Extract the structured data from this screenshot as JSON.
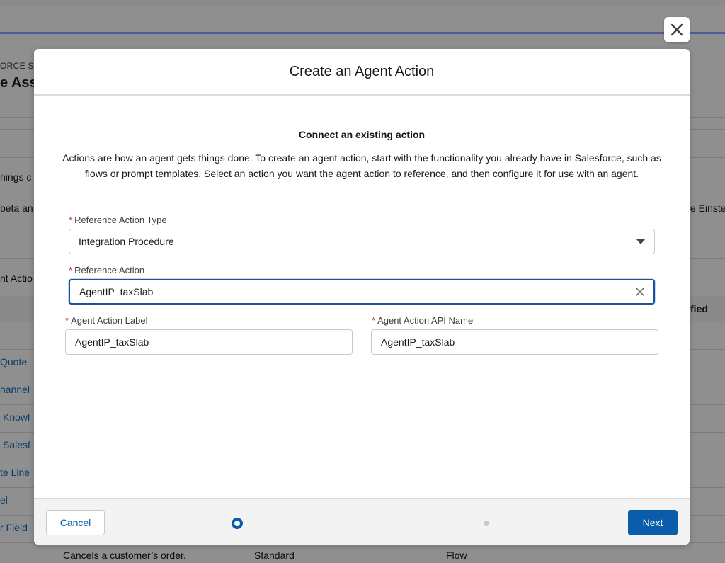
{
  "background": {
    "eyebrow": "ORCE S",
    "title": "e Ass",
    "left_texts": [
      "hings c",
      "beta an",
      "nt Actio"
    ],
    "right_text": "e Einste",
    "column_header_right": "fied",
    "list_links": [
      "Quote",
      "hannel",
      "Knowl",
      "Salesf",
      "te Line",
      "el",
      "r Field"
    ],
    "bottom_row": {
      "description": "Cancels a customer’s order.",
      "type": "Standard",
      "kind": "Flow"
    }
  },
  "close_button": {
    "icon": "close-icon"
  },
  "modal": {
    "title": "Create an Agent Action",
    "section_title": "Connect an existing action",
    "description": "Actions are how an agent gets things done. To create an agent action, start with the functionality you already have in Salesforce, such as flows or prompt templates. Select an action you want the agent action to reference, and then configure it for use with an agent.",
    "required_marker": "*",
    "fields": {
      "reference_action_type": {
        "label": "Reference Action Type",
        "value": "Integration Procedure"
      },
      "reference_action": {
        "label": "Reference Action",
        "value": "AgentIP_taxSlab"
      },
      "agent_action_label": {
        "label": "Agent Action Label",
        "value": "AgentIP_taxSlab"
      },
      "agent_action_api_name": {
        "label": "Agent Action API Name",
        "value": "AgentIP_taxSlab"
      }
    },
    "footer": {
      "cancel_label": "Cancel",
      "next_label": "Next",
      "progress": {
        "current_step": 1,
        "total_steps": 2
      }
    }
  },
  "colors": {
    "brand": "#0b5cab",
    "required": "#c23934",
    "focus_border": "#1b5297"
  }
}
